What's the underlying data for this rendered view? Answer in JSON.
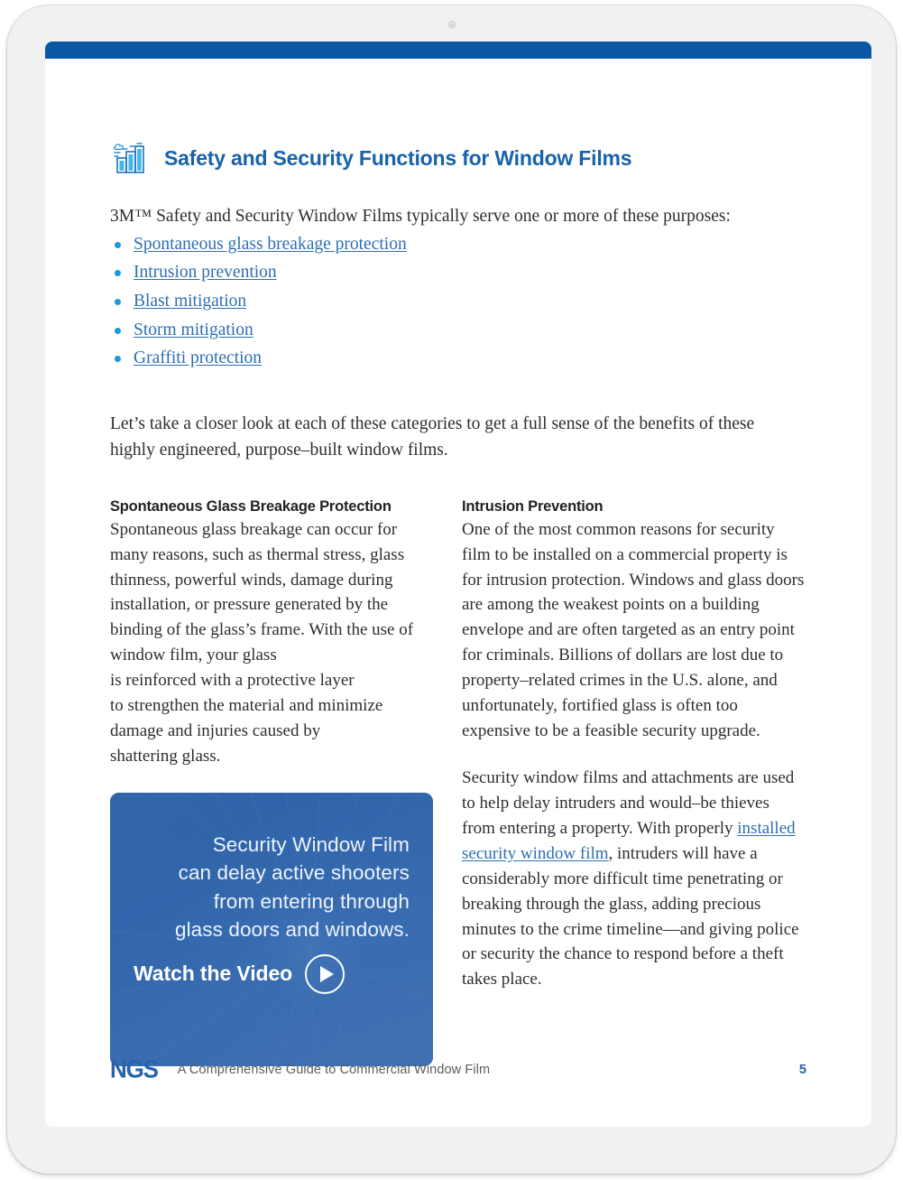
{
  "device": {
    "type": "tablet",
    "camera": "camera-dot"
  },
  "page": {
    "accent_bar_color": "#0b57a4",
    "heading_color": "#1862ac",
    "link_color": "#2d6fb3",
    "bullet_color": "#1b9cd8"
  },
  "section": {
    "icon": "city-skyline-icon",
    "title": "Safety and Security Functions for Window Films",
    "intro": "3M™ Safety and Security Window Films typically serve one or more of these purposes:",
    "bullets": [
      "Spontaneous glass breakage protection",
      "Intrusion prevention",
      "Blast mitigation",
      "Storm mitigation",
      "Graffiti protection"
    ],
    "lede": "Let’s take a closer look at each of these categories to get a full sense of the benefits of these highly engineered, purpose–built window films."
  },
  "columns": {
    "left": {
      "heading": "Spontaneous Glass Breakage Protection",
      "body": "Spontaneous glass breakage can occur for many reasons, such as thermal stress, glass thinness, powerful winds, damage during installation, or pressure generated by the binding of the glass’s frame. With the use of window film, your glass\nis reinforced with a protective layer\nto strengthen the material and minimize damage and injuries caused by\nshattering glass."
    },
    "right": {
      "heading": "Intrusion Prevention",
      "body_1": "One of the most common reasons for security film to be installed on a commercial property is for intrusion protection. Windows and glass doors are among the weakest points on a building envelope and are often targeted as an entry point for criminals. Billions of dollars are lost due to property–related crimes in the U.S. alone, and unfortunately, fortified glass is often too expensive to be a feasible security upgrade.",
      "body_2_before_link": "Security window films and attachments are used to help delay intruders and would–be thieves from entering a property. With properly ",
      "body_2_link": "installed security window film",
      "body_2_after_link": ", intruders will have a considerably more difficult time penetrating or breaking through the glass, adding precious minutes to the crime timeline—and giving police or security the chance to respond before a theft takes place."
    }
  },
  "video_card": {
    "headline": "Security Window Film\ncan delay active shooters\nfrom entering through\nglass doors and windows.",
    "cta_label": "Watch the Video",
    "play_icon": "play-triangle-icon",
    "overlay_color": "#255ca6"
  },
  "footer": {
    "logo": "NGS",
    "title": "A Comprehensive Guide to Commercial Window Film",
    "page_number": "5"
  }
}
